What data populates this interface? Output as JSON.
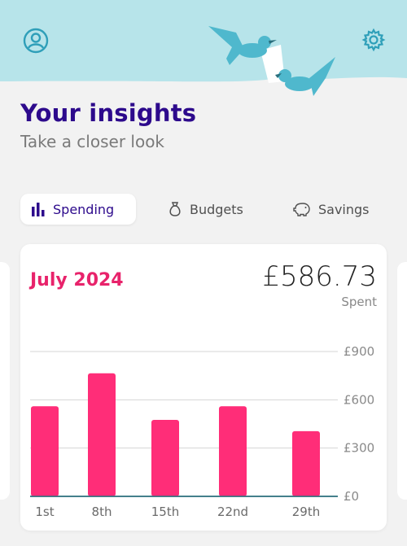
{
  "header": {
    "bg_color": "#b7e4ea",
    "profile_icon": "user-circle-icon",
    "settings_icon": "gear-icon"
  },
  "page": {
    "title": "Your insights",
    "subtitle": "Take a closer look"
  },
  "tabs": [
    {
      "label": "Spending",
      "icon": "bar-chart-icon",
      "active": true
    },
    {
      "label": "Budgets",
      "icon": "money-bag-icon",
      "active": false
    },
    {
      "label": "Savings",
      "icon": "piggy-bank-icon",
      "active": false
    }
  ],
  "card": {
    "month": "July 2024",
    "amount": "£586.73",
    "amount_label": "Spent"
  },
  "chart_data": {
    "type": "bar",
    "categories": [
      "1st",
      "8th",
      "15th",
      "22nd",
      "29th"
    ],
    "values": [
      560,
      765,
      475,
      560,
      405
    ],
    "ylim": [
      0,
      900
    ],
    "yticks": [
      0,
      300,
      600,
      900
    ],
    "ytick_labels": [
      "£0",
      "£300",
      "£600",
      "£900"
    ],
    "bar_color": "#ff2d78",
    "grid": true
  }
}
